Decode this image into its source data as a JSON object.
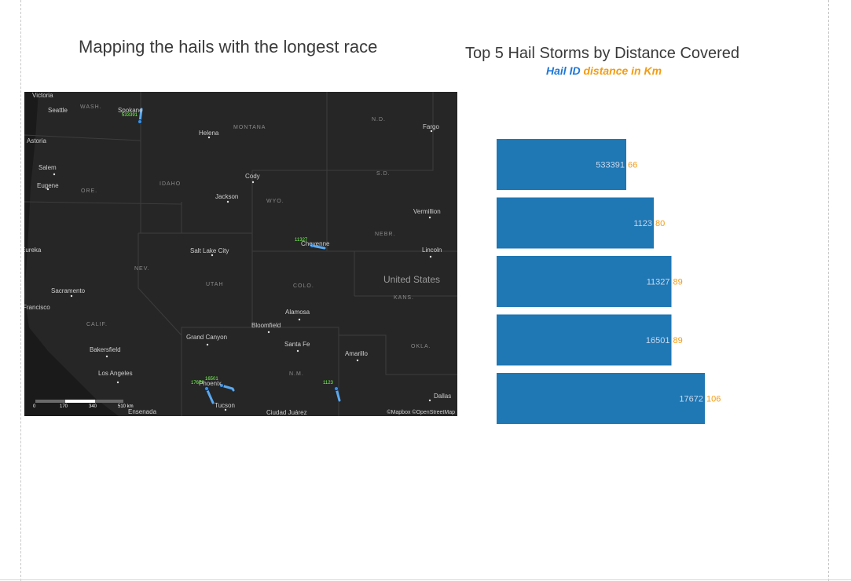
{
  "left_panel": {
    "title": "Mapping the hails with the longest race"
  },
  "map": {
    "labels": [
      {
        "text": "Victoria",
        "kind": "city"
      },
      {
        "text": "Seattle",
        "kind": "city"
      },
      {
        "text": "WASH.",
        "kind": "state"
      },
      {
        "text": "Spokane",
        "kind": "city"
      },
      {
        "text": "Astoria",
        "kind": "city"
      },
      {
        "text": "Salem",
        "kind": "city"
      },
      {
        "text": "Eugene",
        "kind": "city"
      },
      {
        "text": "ORE.",
        "kind": "state"
      },
      {
        "text": "IDAHO",
        "kind": "state"
      },
      {
        "text": "Helena",
        "kind": "city"
      },
      {
        "text": "MONTANA",
        "kind": "state"
      },
      {
        "text": "Cody",
        "kind": "city"
      },
      {
        "text": "WYO.",
        "kind": "state"
      },
      {
        "text": "Jackson",
        "kind": "city"
      },
      {
        "text": "N.D.",
        "kind": "state"
      },
      {
        "text": "Fargo",
        "kind": "city"
      },
      {
        "text": "S.D.",
        "kind": "state"
      },
      {
        "text": "Vermillion",
        "kind": "city"
      },
      {
        "text": "NEBR.",
        "kind": "state"
      },
      {
        "text": "Lincoln",
        "kind": "city"
      },
      {
        "text": "Cheyenne",
        "kind": "city"
      },
      {
        "text": "Eureka",
        "kind": "city"
      },
      {
        "text": "Salt Lake City",
        "kind": "city"
      },
      {
        "text": "NEV.",
        "kind": "state"
      },
      {
        "text": "UTAH",
        "kind": "state"
      },
      {
        "text": "COLO.",
        "kind": "state"
      },
      {
        "text": "United States",
        "kind": "country"
      },
      {
        "text": "KANS.",
        "kind": "state"
      },
      {
        "text": "Sacramento",
        "kind": "city"
      },
      {
        "text": "Francisco",
        "kind": "city"
      },
      {
        "text": "CALIF.",
        "kind": "state"
      },
      {
        "text": "Alamosa",
        "kind": "city"
      },
      {
        "text": "Bloomfield",
        "kind": "city"
      },
      {
        "text": "Grand Canyon",
        "kind": "city"
      },
      {
        "text": "Santa Fe",
        "kind": "city"
      },
      {
        "text": "OKLA.",
        "kind": "state"
      },
      {
        "text": "Amarillo",
        "kind": "city"
      },
      {
        "text": "Bakersfield",
        "kind": "city"
      },
      {
        "text": "Los Angeles",
        "kind": "city"
      },
      {
        "text": "N.M.",
        "kind": "state"
      },
      {
        "text": "Tucson",
        "kind": "city"
      },
      {
        "text": "Ensenada",
        "kind": "city"
      },
      {
        "text": "Ciudad Juárez",
        "kind": "city"
      },
      {
        "text": "Dallas",
        "kind": "city"
      },
      {
        "text": "Phoenix",
        "kind": "city"
      }
    ],
    "markers": [
      "533391",
      "11327",
      "16501",
      "17672",
      "1123"
    ],
    "scale": [
      "0",
      "170",
      "340",
      "510 km"
    ],
    "attribution": "©Mapbox ©OpenStreetMap",
    "colors": {
      "background": "#262626",
      "track": "#5aa9f0",
      "marker_text": "#7dff5a"
    }
  },
  "right_panel": {
    "title": "Top 5 Hail Storms by Distance Covered",
    "legend_id": "Hail ID",
    "legend_distance": "distance in Km"
  },
  "chart_data": {
    "type": "bar",
    "orientation": "horizontal",
    "title": "Top 5 Hail Storms by Distance Covered",
    "subtitle": "Hail ID distance in Km",
    "categories": [
      "533391",
      "1123",
      "11327",
      "16501",
      "17672"
    ],
    "values": [
      66,
      80,
      89,
      89,
      106
    ],
    "xlim": [
      0,
      140
    ],
    "bar_color": "#1f77b4",
    "id_label_color": "#c7d9ee",
    "value_label_color": "#f39c12",
    "grid": false
  }
}
